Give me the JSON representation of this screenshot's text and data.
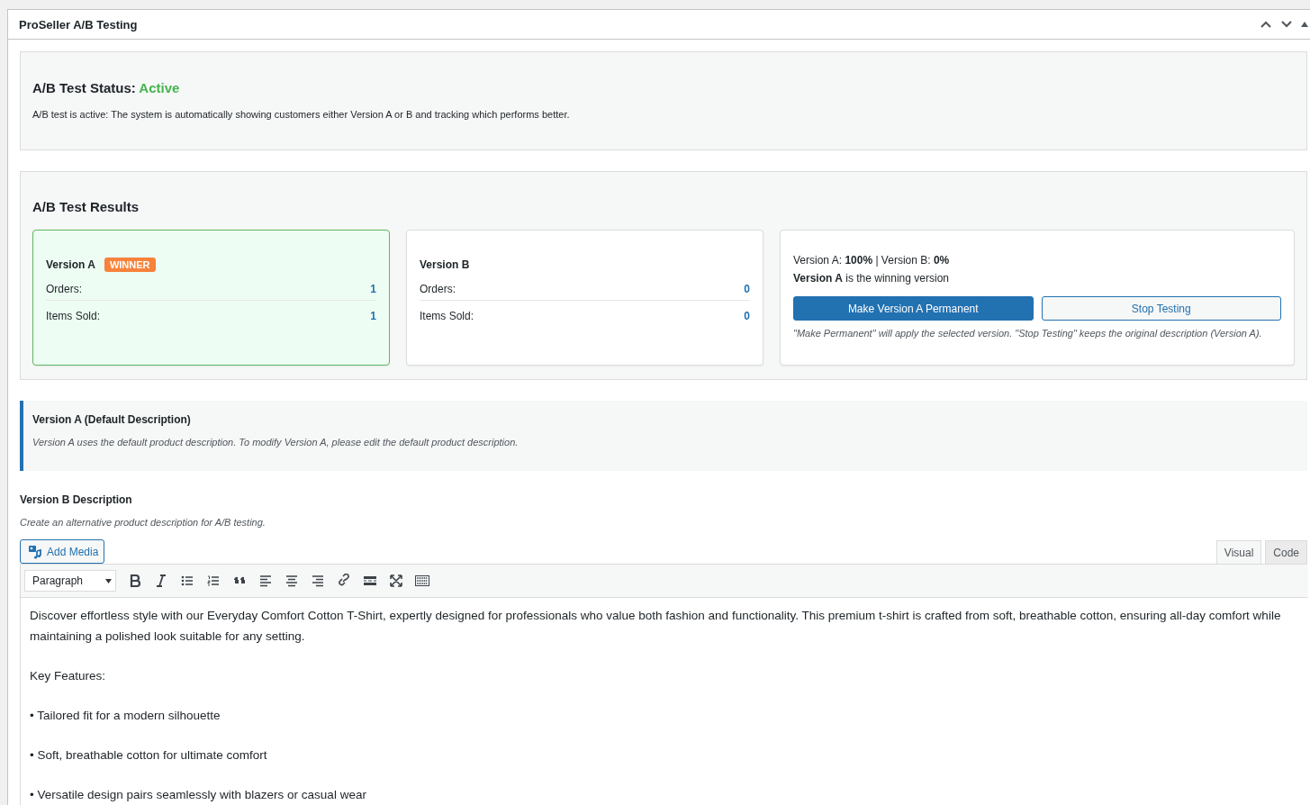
{
  "panel": {
    "title": "ProSeller A/B Testing"
  },
  "status": {
    "label": "A/B Test Status:",
    "value": "Active",
    "active": true,
    "message": "A/B test is active: The system is automatically showing customers either Version A or B and tracking which performs better."
  },
  "results": {
    "title": "A/B Test Results",
    "versions": [
      {
        "name": "Version A",
        "winner": true,
        "badge": "WINNER",
        "stats": [
          {
            "label": "Orders:",
            "value": "1"
          },
          {
            "label": "Items Sold:",
            "value": "1"
          }
        ]
      },
      {
        "name": "Version B",
        "winner": false,
        "stats": [
          {
            "label": "Orders:",
            "value": "0"
          },
          {
            "label": "Items Sold:",
            "value": "0"
          }
        ]
      }
    ],
    "split": "Version A: **100%** | Version B: **0%**",
    "verdict": "**Version A** is the winning version",
    "buttons": [
      {
        "label": "Make Version A Permanent",
        "kind": "primary"
      },
      {
        "label": "Stop Testing",
        "kind": "secondary"
      }
    ],
    "note": "\"Make Permanent\" will apply the selected version. \"Stop Testing\" keeps the original description (Version A)."
  },
  "version_a": {
    "title": "Version A (Default Description)",
    "note": "Version A uses the default product description. To modify Version A, please edit the default product description."
  },
  "version_b": {
    "title": "Version B Description",
    "hint": "Create an alternative product description for A/B testing.",
    "add_media": "Add Media",
    "tabs": [
      {
        "label": "Visual",
        "selected": true
      },
      {
        "label": "Code",
        "selected": false
      }
    ],
    "format": "Paragraph",
    "paragraphs": [
      "Discover effortless style with our Everyday Comfort Cotton T-Shirt, expertly designed for professionals who value both fashion and functionality. This premium t-shirt is crafted from soft, breathable cotton, ensuring all-day comfort while maintaining a polished look suitable for any setting.",
      "Key Features:",
      "• Tailored fit for a modern silhouette",
      "• Soft, breathable cotton for ultimate comfort",
      "• Versatile design pairs seamlessly with blazers or casual wear"
    ]
  }
}
